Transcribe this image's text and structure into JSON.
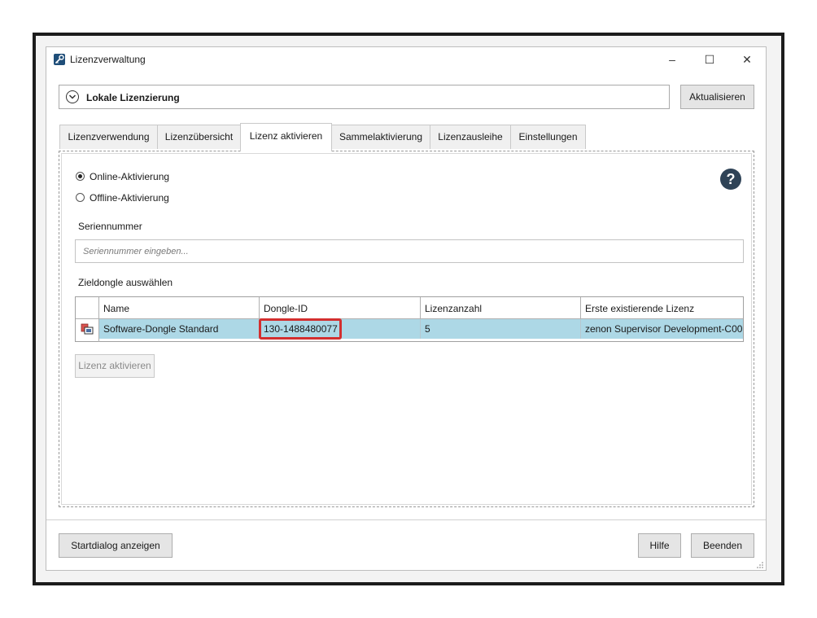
{
  "window": {
    "title": "Lizenzverwaltung",
    "minimize": "–",
    "maximize": "☐",
    "close": "✕"
  },
  "header": {
    "section_label": "Lokale Lizenzierung",
    "refresh_label": "Aktualisieren"
  },
  "tabs": [
    {
      "label": "Lizenzverwendung"
    },
    {
      "label": "Lizenzübersicht"
    },
    {
      "label": "Lizenz aktivieren",
      "active": true
    },
    {
      "label": "Sammelaktivierung"
    },
    {
      "label": "Lizenzausleihe"
    },
    {
      "label": "Einstellungen"
    }
  ],
  "activation": {
    "online_label": "Online-Aktivierung",
    "offline_label": "Offline-Aktivierung",
    "selected": "online",
    "help_glyph": "?",
    "serial_label": "Seriennummer",
    "serial_placeholder": "Seriennummer eingeben...",
    "serial_value": "",
    "target_label": "Zieldongle auswählen",
    "activate_label": "Lizenz aktivieren"
  },
  "table": {
    "columns": [
      "Name",
      "Dongle-ID",
      "Lizenzanzahl",
      "Erste existierende Lizenz"
    ],
    "rows": [
      {
        "icon": "dongle-icon",
        "name": "Software-Dongle Standard",
        "dongle_id": "130-1488480077",
        "count": "5",
        "first_license": "zenon Supervisor Development-C00"
      }
    ],
    "selected_row_color": "#add8e6",
    "highlight_color": "#d32f2f"
  },
  "footer": {
    "start_dialog_label": "Startdialog anzeigen",
    "help_label": "Hilfe",
    "quit_label": "Beenden"
  }
}
